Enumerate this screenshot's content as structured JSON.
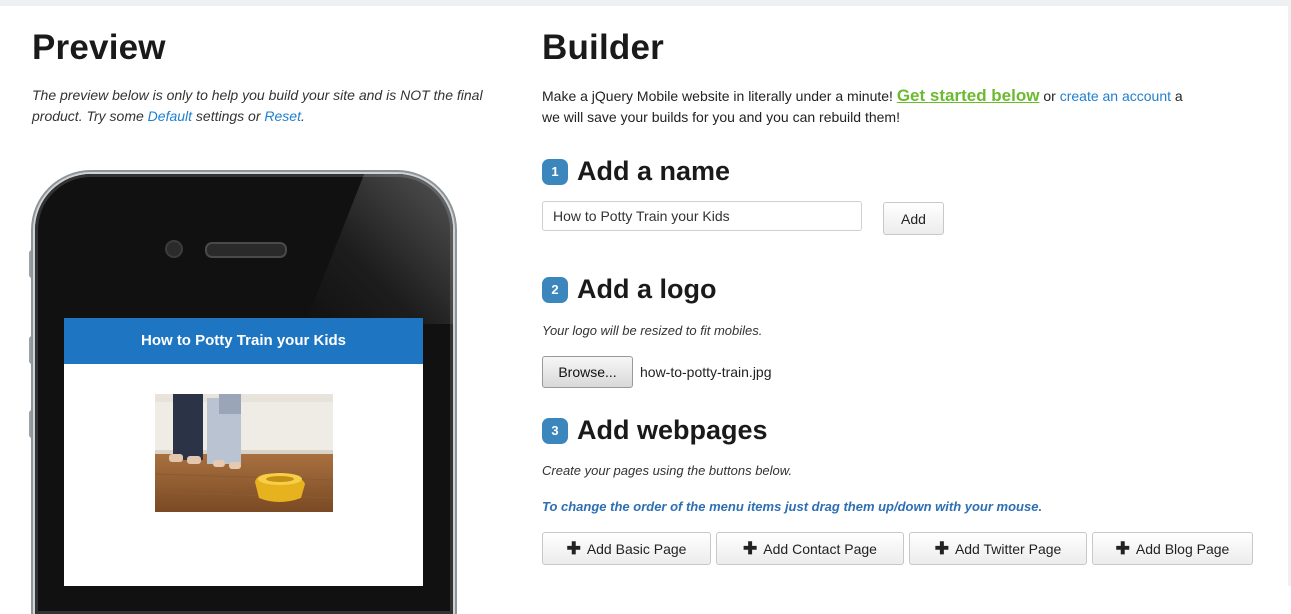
{
  "preview": {
    "title": "Preview",
    "desc_before": "The preview below is only to help you build your site and is NOT the final product. Try some ",
    "default_link": "Default",
    "desc_middle": " settings or ",
    "reset_link": "Reset",
    "desc_after": ".",
    "phone_header": "How to Potty Train your Kids"
  },
  "builder": {
    "title": "Builder",
    "intro_before": "Make a jQuery Mobile website in literally under a minute! ",
    "get_started": "Get started below",
    "intro_or": " or ",
    "create_account": "create an account",
    "intro_after": " a",
    "intro_line2": "we will save your builds for you and you can rebuild them!",
    "steps": [
      {
        "num": "1",
        "title": "Add a name"
      },
      {
        "num": "2",
        "title": "Add a logo"
      },
      {
        "num": "3",
        "title": "Add webpages"
      }
    ],
    "name_value": "How to Potty Train your Kids",
    "add_button": "Add",
    "logo_note": "Your logo will be resized to fit mobiles.",
    "browse_button": "Browse...",
    "logo_filename": "how-to-potty-train.jpg",
    "pages_note": "Create your pages using the buttons below.",
    "order_note": "To change the order of the menu items just drag them up/down with your mouse.",
    "page_buttons": [
      "Add Basic Page",
      "Add Contact Page",
      "Add Twitter Page",
      "Add Blog Page"
    ]
  },
  "colors": {
    "accent_blue": "#1e75c2",
    "link_blue": "#1e7fd0",
    "get_started_green": "#6cba2f",
    "step_badge": "#3b86bd"
  },
  "icons": [
    "plus-icon",
    "camera",
    "speaker"
  ]
}
